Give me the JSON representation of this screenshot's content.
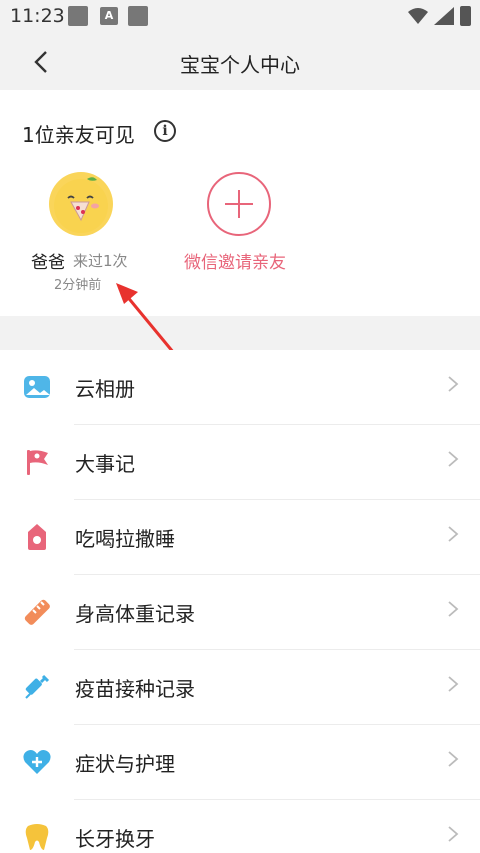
{
  "status_bar": {
    "time": "11:23",
    "notif_letter": "A"
  },
  "navbar": {
    "title": "宝宝个人中心",
    "back_icon": "chevron-left-icon"
  },
  "family": {
    "title": "1位亲友可见",
    "member": {
      "name": "爸爸",
      "visits": "来过1次",
      "last_seen": "2分钟前"
    },
    "invite_label": "微信邀请亲友",
    "accent": "#e8657a"
  },
  "menu": {
    "items": [
      {
        "label": "云相册",
        "icon": "photo-album-icon",
        "color": "#4fb6e8"
      },
      {
        "label": "大事记",
        "icon": "flag-icon",
        "color": "#e8657a"
      },
      {
        "label": "吃喝拉撒睡",
        "icon": "baby-bottle-icon",
        "color": "#e8657a"
      },
      {
        "label": "身高体重记录",
        "icon": "ruler-icon",
        "color": "#f28c5a"
      },
      {
        "label": "疫苗接种记录",
        "icon": "syringe-icon",
        "color": "#3fb0e6"
      },
      {
        "label": "症状与护理",
        "icon": "heart-cross-icon",
        "color": "#3fb0e6"
      },
      {
        "label": "长牙换牙",
        "icon": "tooth-icon",
        "color": "#f5c33b"
      }
    ]
  }
}
